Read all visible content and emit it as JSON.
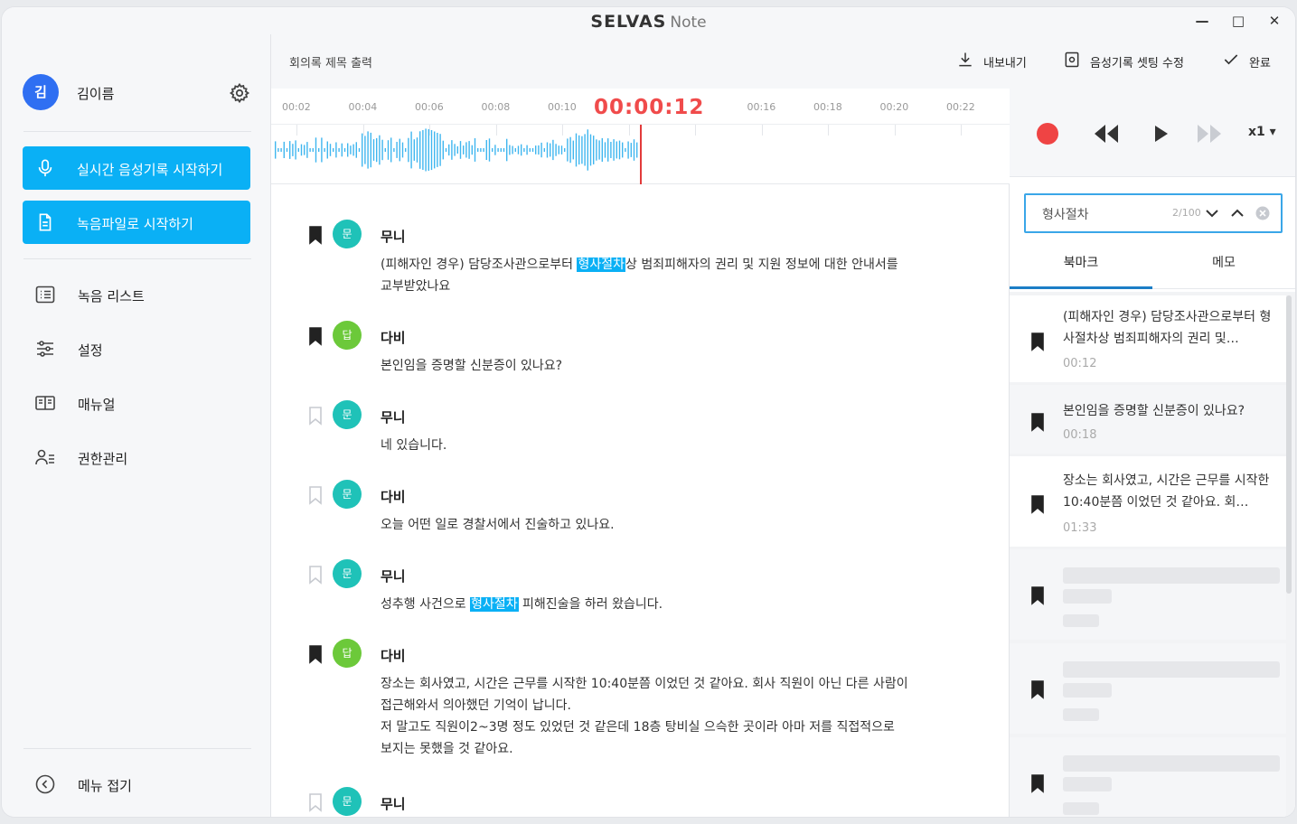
{
  "window": {
    "logo": "SELVAS",
    "app_name": "Note",
    "minimize": "—",
    "maximize": "□",
    "close": "✕"
  },
  "sidebar": {
    "avatar_initial": "김",
    "user_name": "김이름",
    "buttons": [
      {
        "label": "실시간 음성기록 시작하기",
        "icon": "microphone-icon"
      },
      {
        "label": "녹음파일로 시작하기",
        "icon": "document-icon"
      }
    ],
    "nav": [
      {
        "label": "녹음 리스트",
        "icon": "list-icon"
      },
      {
        "label": "설정",
        "icon": "sliders-icon"
      },
      {
        "label": "매뉴얼",
        "icon": "book-icon"
      },
      {
        "label": "권한관리",
        "icon": "user-permission-icon"
      }
    ],
    "collapse_label": "메뉴 접기"
  },
  "header": {
    "title": "회의록 제목 출력",
    "actions": [
      {
        "label": "내보내기",
        "icon": "download-icon"
      },
      {
        "label": "음성기록 셋팅 수정",
        "icon": "settings-doc-icon"
      },
      {
        "label": "완료",
        "icon": "check-icon"
      }
    ]
  },
  "timeline": {
    "ticks": [
      "00:02",
      "00:04",
      "00:06",
      "00:08",
      "00:10",
      "00:12",
      ":14",
      "00:16",
      "00:18",
      "00:20",
      "00:22"
    ],
    "current_time": "00:00:12"
  },
  "player": {
    "speed": "x1 ▾",
    "colors": {
      "record": "#ef4444",
      "accent": "#0ab0f5"
    }
  },
  "search": {
    "query": "형사절차",
    "count": "2/100"
  },
  "tabs": [
    "북마크",
    "메모"
  ],
  "transcript": [
    {
      "bookmarked": true,
      "badge": "문",
      "badge_color": "#1fc2b8",
      "speaker": "무니",
      "parts": [
        [
          "(피해자인 경우) 담당조사관으로부터 ",
          false
        ],
        [
          "형사절차",
          true
        ],
        [
          "상 범죄피해자의 권리 및 지원 정보에 대한 안내서를\n교부받았나요",
          false
        ]
      ]
    },
    {
      "bookmarked": true,
      "badge": "답",
      "badge_color": "#6cc93a",
      "speaker": "다비",
      "parts": [
        [
          "본인임을 증명할 신분증이 있나요?",
          false
        ]
      ]
    },
    {
      "bookmarked": false,
      "badge": "문",
      "badge_color": "#1fc2b8",
      "speaker": "무니",
      "parts": [
        [
          "네 있습니다.",
          false
        ]
      ]
    },
    {
      "bookmarked": false,
      "badge": "문",
      "badge_color": "#1fc2b8",
      "speaker": "다비",
      "parts": [
        [
          "오늘 어떤 일로 경찰서에서 진술하고 있나요.",
          false
        ]
      ]
    },
    {
      "bookmarked": false,
      "badge": "문",
      "badge_color": "#1fc2b8",
      "speaker": "무니",
      "parts": [
        [
          "성추행 사건으로 ",
          false
        ],
        [
          "형사절차",
          true
        ],
        [
          " 피해진술을 하러 왔습니다.",
          false
        ]
      ]
    },
    {
      "bookmarked": true,
      "badge": "답",
      "badge_color": "#6cc93a",
      "speaker": "다비",
      "parts": [
        [
          "장소는 회사였고, 시간은 근무를 시작한 10:40분쯤 이었던 것 같아요. 회사 직원이 아닌 다른 사람이\n접근해와서 의아했던 기억이 납니다.\n저 말고도 직원이2~3명 정도 있었던 것 같은데 18층 탕비실 으슥한 곳이라 아마 저를 직접적으로\n보지는 못했을 것 같아요.",
          false
        ]
      ]
    },
    {
      "bookmarked": false,
      "badge": "문",
      "badge_color": "#1fc2b8",
      "speaker": "무니",
      "parts": [
        [
          "",
          false
        ]
      ]
    }
  ],
  "bookmarks": [
    {
      "text": "(피해자인 경우) 담당조사관으로부터 형사절차상 범죄피해자의 권리 및…",
      "time": "00:12"
    },
    {
      "text": "본인임을 증명할 신분증이 있나요?",
      "time": "00:18"
    },
    {
      "text": "장소는 회사였고, 시간은 근무를 시작한 10:40분쯤 이었던 것 같아요. 회…",
      "time": "01:33"
    }
  ]
}
